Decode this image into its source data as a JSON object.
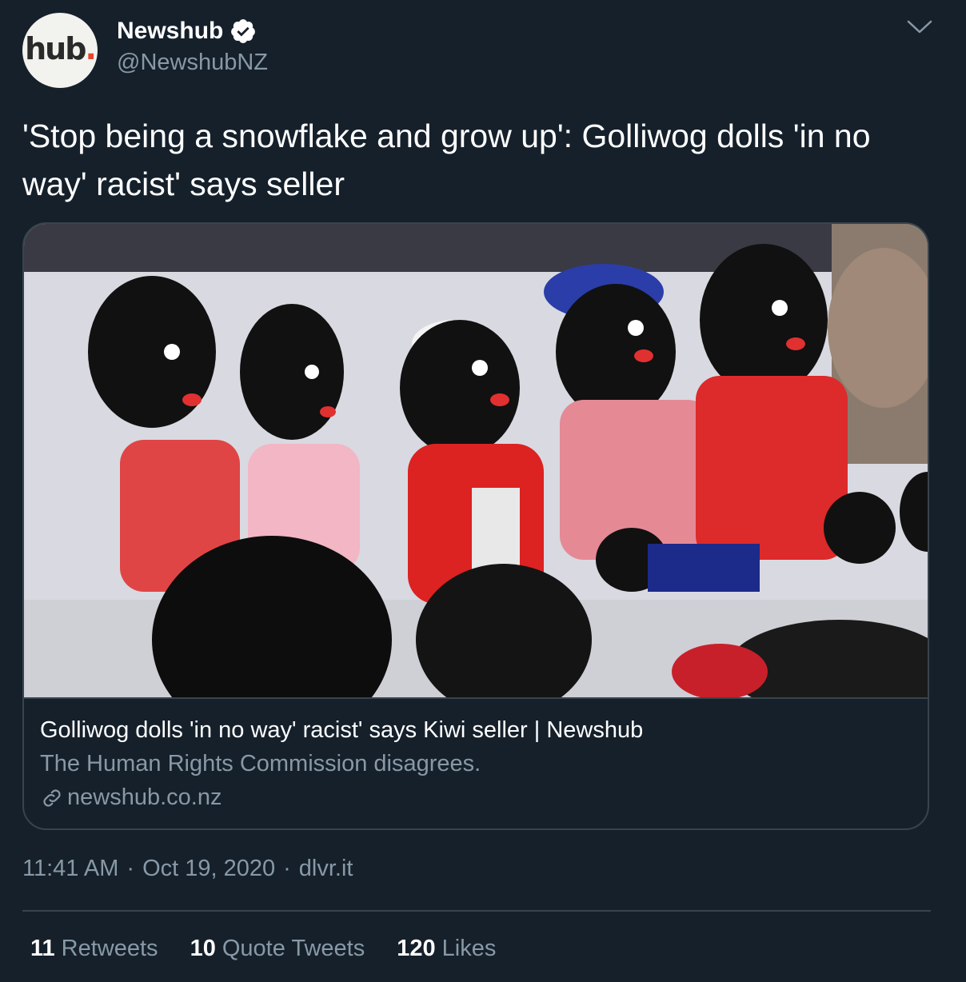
{
  "account": {
    "avatar_text": "hub",
    "avatar_dot": ".",
    "display_name": "Newshub",
    "handle": "@NewshubNZ",
    "verified": true
  },
  "tweet": {
    "text": "'Stop being a snowflake and grow up': Golliwog dolls 'in no way' racist' says seller"
  },
  "card": {
    "image_icon": "photo-of-dolls",
    "title": "Golliwog dolls 'in no way' racist' says Kiwi seller | Newshub",
    "description": "The Human Rights Commission disagrees.",
    "domain": "newshub.co.nz"
  },
  "meta": {
    "time": "11:41 AM",
    "sep1": "·",
    "date": "Oct 19, 2020",
    "sep2": "·",
    "source": "dlvr.it"
  },
  "stats": {
    "retweets_count": "11",
    "retweets_label": "Retweets",
    "quotes_count": "10",
    "quotes_label": "Quote Tweets",
    "likes_count": "120",
    "likes_label": "Likes"
  },
  "colors": {
    "background": "#15202b",
    "border": "#38444d",
    "secondary_text": "#8899a6",
    "primary_text": "#ffffff",
    "verified_badge": "#ffffff"
  }
}
